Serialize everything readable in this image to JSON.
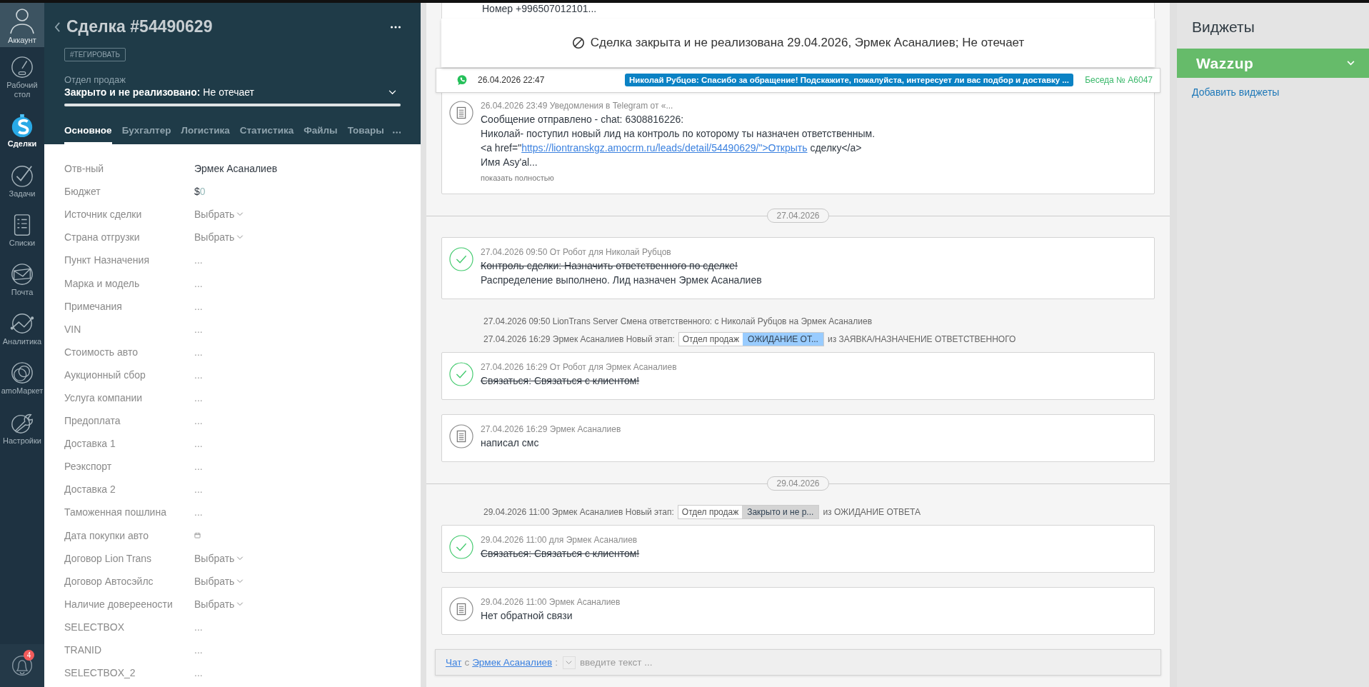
{
  "nav": {
    "account": "Аккаунт",
    "items": [
      {
        "label": "Рабочий стол",
        "selected": false
      },
      {
        "label": "Сделки",
        "selected": true
      },
      {
        "label": "Задачи",
        "selected": false
      },
      {
        "label": "Списки",
        "selected": false
      },
      {
        "label": "Почта",
        "selected": false
      },
      {
        "label": "Аналитика",
        "selected": false
      },
      {
        "label": "amoМаркет",
        "selected": false
      },
      {
        "label": "Настройки",
        "selected": false
      }
    ],
    "notifications": "4"
  },
  "lead": {
    "title": "Сделка #54490629",
    "tag_button": "#ТЕГИРОВАТЬ",
    "pipeline": "Отдел продаж",
    "status": "Закрыто и не реализовано:",
    "reason": "Не отечает",
    "progress": {
      "level": 1
    },
    "tabs": [
      {
        "label": "Основное",
        "selected": true
      },
      {
        "label": "Бухгалтер",
        "selected": false
      },
      {
        "label": "Логистика",
        "selected": false
      },
      {
        "label": "Статистика",
        "selected": false
      },
      {
        "label": "Файлы",
        "selected": false
      },
      {
        "label": "Товары",
        "selected": false
      }
    ]
  },
  "fields": [
    {
      "label": "Отв-ный",
      "kind": "text",
      "value": "Эрмек Асаналиев"
    },
    {
      "label": "Бюджет",
      "kind": "money",
      "currency": "$",
      "value": "0"
    },
    {
      "label": "Источник сделки",
      "kind": "select",
      "placeholder": "Выбрать"
    },
    {
      "label": "Страна отгрузки",
      "kind": "select",
      "placeholder": "Выбрать"
    },
    {
      "label": "Пункт Назначения",
      "kind": "empty",
      "placeholder": "..."
    },
    {
      "label": "Марка и модель",
      "kind": "empty",
      "placeholder": "..."
    },
    {
      "label": "Примечания",
      "kind": "empty",
      "placeholder": "..."
    },
    {
      "label": "VIN",
      "kind": "empty",
      "placeholder": "..."
    },
    {
      "label": "Стоимость авто",
      "kind": "empty",
      "placeholder": "..."
    },
    {
      "label": "Аукционный сбор",
      "kind": "empty",
      "placeholder": "..."
    },
    {
      "label": "Услуга компании",
      "kind": "empty",
      "placeholder": "..."
    },
    {
      "label": "Предоплата",
      "kind": "empty",
      "placeholder": "..."
    },
    {
      "label": "Доставка 1",
      "kind": "empty",
      "placeholder": "..."
    },
    {
      "label": "Реэкспорт",
      "kind": "empty",
      "placeholder": "..."
    },
    {
      "label": "Доставка 2",
      "kind": "empty",
      "placeholder": "..."
    },
    {
      "label": "Таможенная пошлина",
      "kind": "empty",
      "placeholder": "..."
    },
    {
      "label": "Дата покупки авто",
      "kind": "date"
    },
    {
      "label": "Договор Lion Trans",
      "kind": "select",
      "placeholder": "Выбрать"
    },
    {
      "label": "Договор Автосэйлс",
      "kind": "select",
      "placeholder": "Выбрать"
    },
    {
      "label": "Наличие довереености",
      "kind": "select",
      "placeholder": "Выбрать"
    },
    {
      "label": "SELECTBOX",
      "kind": "empty",
      "placeholder": "..."
    },
    {
      "label": "TRANID",
      "kind": "empty",
      "placeholder": "..."
    },
    {
      "label": "SELECTBOX_2",
      "kind": "empty",
      "placeholder": "..."
    }
  ],
  "feed": {
    "top_fragment": "Номер +996507012101...",
    "banner": "Сделка закрыта и не реализована 29.04.2026, Эрмек Асаналиев; Не отечает",
    "chat_row": {
      "time": "26.04.2026 22:47",
      "message": "Николай Рубцов: Спасибо за обращение! Подскажите, пожалуйста, интересует ли вас подбор и доставку ...",
      "conversation": "Беседа № A6047"
    },
    "items": [
      {
        "kind": "note",
        "meta": "26.04.2026 23:49 Уведомления в Telegram от «...",
        "lines": [
          [
            {
              "text": "Сообщение отправлено - chat: 6308816226:",
              "link": false
            }
          ],
          [
            {
              "text": "Николай- поступил новый лид на контроль по которому ты назначен ответственным.",
              "link": false
            }
          ],
          [
            {
              "text": "<a href=\"",
              "link": false
            },
            {
              "text": "https://liontranskgz.amocrm.ru/leads/detail/54490629/\">Открыть",
              "link": true
            },
            {
              "text": " сделку</a>",
              "link": false
            }
          ],
          [
            {
              "text": "Имя Asy'al...",
              "link": false
            }
          ]
        ],
        "more": "показать полностью"
      },
      {
        "kind": "date",
        "date": "27.04.2026"
      },
      {
        "kind": "task",
        "meta": "27.04.2026 09:50  От Робот для Николай Рубцов",
        "lines": [
          {
            "text": "Контроль сделки: Назначить ответственного по сделке!",
            "struck": true
          },
          {
            "text": "Распределение выполнено. Лид назначен Эрмек Асаналиев",
            "struck": false
          }
        ]
      },
      {
        "kind": "event",
        "text": "27.04.2026 09:50 LionTrans Server Смена ответственного: с Николай Рубцов на Эрмек Асаналиев"
      },
      {
        "kind": "stage",
        "meta": "27.04.2026 16:29 Эрмек Асаналиев Новый этап:",
        "pipeline": "Отдел продаж",
        "stage": "ОЖИДАНИЕ ОТ...",
        "color": "#99ccff",
        "from": "из ЗАЯВКА/НАЗНАЧЕНИЕ ОТВЕТСТВЕННОГО"
      },
      {
        "kind": "task",
        "meta": "27.04.2026 16:29  От Робот для Эрмек Асаналиев",
        "lines": [
          {
            "text": "Связаться: Связаться с клиентом!",
            "struck": true
          }
        ]
      },
      {
        "kind": "note",
        "meta": "27.04.2026 16:29 Эрмек Асаналиев",
        "lines": [
          [
            {
              "text": "написал смс",
              "link": false
            }
          ]
        ]
      },
      {
        "kind": "date",
        "date": "29.04.2026"
      },
      {
        "kind": "stage",
        "meta": "29.04.2026 11:00 Эрмек Асаналиев Новый этап:",
        "pipeline": "Отдел продаж",
        "stage": "Закрыто и не р...",
        "color": "#d4d4d4",
        "from": "из ОЖИДАНИЕ ОТВЕТА"
      },
      {
        "kind": "task",
        "meta": "29.04.2026 11:00  для Эрмек Асаналиев",
        "lines": [
          {
            "text": "Связаться: Связаться с клиентом!",
            "struck": true
          }
        ]
      },
      {
        "kind": "note",
        "meta": "29.04.2026 11:00 Эрмек Асаналиев",
        "lines": [
          [
            {
              "text": "Нет обратной связи",
              "link": false
            }
          ]
        ]
      }
    ],
    "composer": {
      "chat_link": "Чат",
      "with": "с",
      "contact_link": "Эрмек Асаналиев",
      "colon": ":",
      "placeholder": "введите текст ..."
    }
  },
  "widgets": {
    "title": "Виджеты",
    "items": [
      "Wazzup"
    ],
    "add_link": "Добавить виджеты"
  }
}
